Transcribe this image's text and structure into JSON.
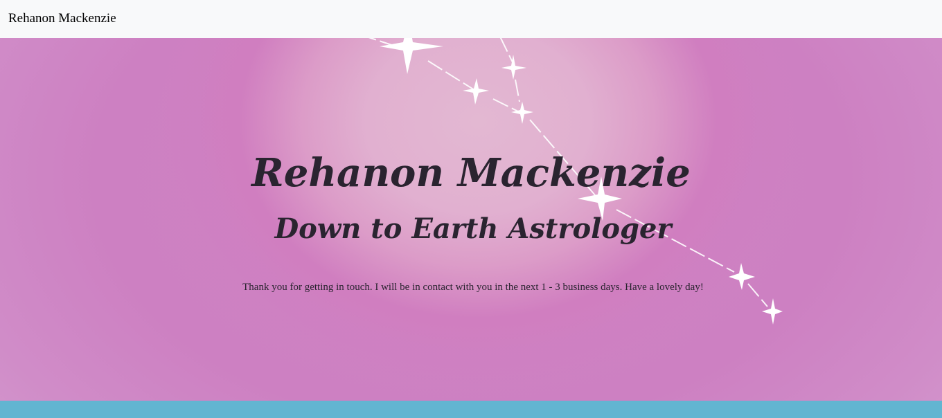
{
  "navbar": {
    "brand": "Rehanon Mackenzie"
  },
  "hero": {
    "title": "Rehanon Mackenzie",
    "subtitle": "Down to Earth Astrologer",
    "message": "Thank you for getting in touch. I will be in contact with you in the next 1 - 3 business days. Have a lovely day!"
  },
  "colors": {
    "navbar_bg": "#f8f9fa",
    "hero_pink": "#cf85c4",
    "hero_glow": "#e3b8d2",
    "text_dark": "#2a2430",
    "footer_band": "#62b5d1",
    "star": "#ffffff"
  },
  "icons": {
    "constellation": "constellation-graphic"
  }
}
